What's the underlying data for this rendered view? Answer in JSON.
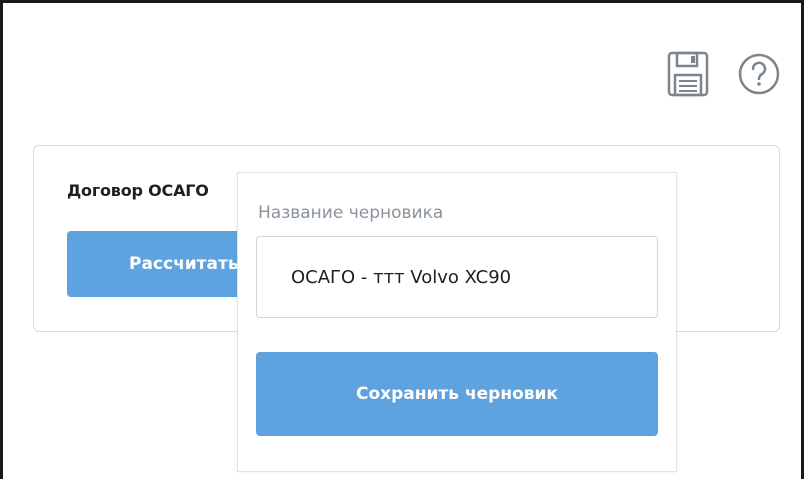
{
  "toolbar": {
    "save_icon": "floppy-disk-icon",
    "help_icon": "question-circle-icon"
  },
  "card": {
    "title": "Договор ОСАГО",
    "calc_button_label": "Рассчитать"
  },
  "popover": {
    "field_label": "Название черновика",
    "draft_name_value": "ОСАГО - ттт Volvo XC90",
    "save_button_label": "Сохранить черновик"
  },
  "colors": {
    "accent": "#5fa2e0",
    "label_gray": "#8a939c",
    "icon_gray": "#7d858c",
    "border": "#d6dde6"
  }
}
